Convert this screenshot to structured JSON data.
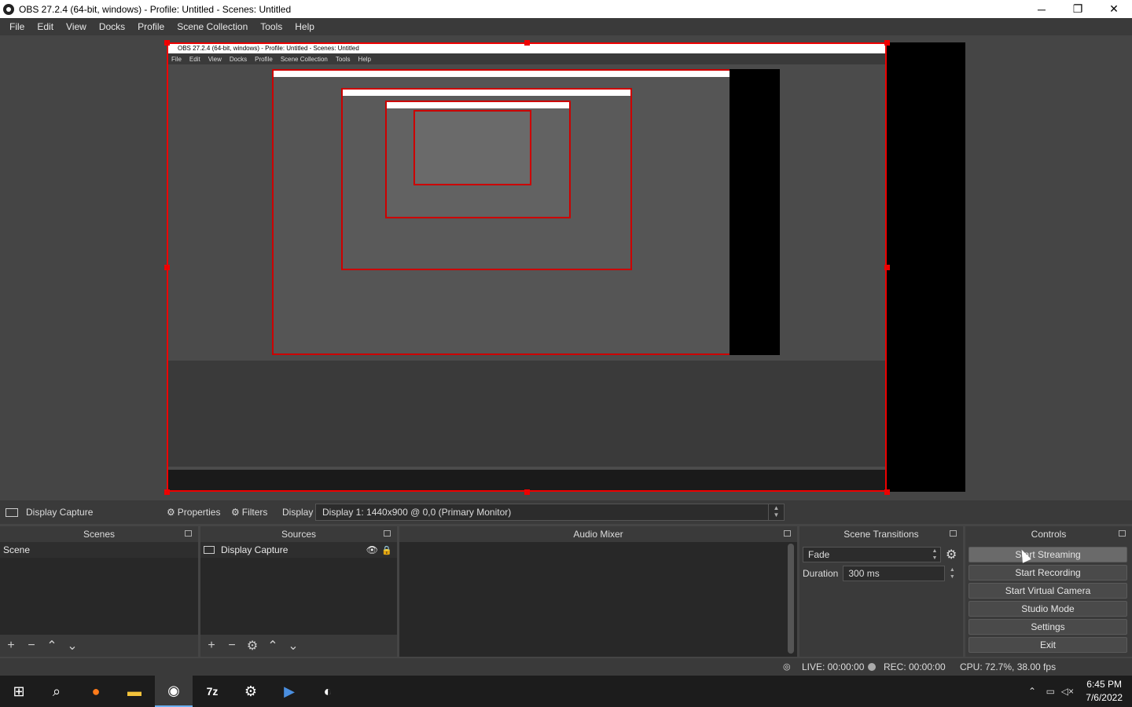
{
  "window": {
    "title": "OBS 27.2.4 (64-bit, windows) - Profile: Untitled - Scenes: Untitled",
    "controls": {
      "minimize": "─",
      "restore": "❐",
      "close": "✕"
    }
  },
  "menubar": {
    "items": [
      "File",
      "Edit",
      "View",
      "Docks",
      "Profile",
      "Scene Collection",
      "Tools",
      "Help"
    ]
  },
  "preview": {
    "captured": {
      "title": "OBS 27.2.4 (64-bit, windows) - Profile: Untitled - Scenes: Untitled",
      "menu": [
        "File",
        "Edit",
        "View",
        "Docks",
        "Profile",
        "Scene Collection",
        "Tools",
        "Help"
      ]
    },
    "selection_color": "#e00000"
  },
  "source_toolbar": {
    "source_name": "Display Capture",
    "properties_label": "Properties",
    "filters_label": "Filters",
    "display_label": "Display",
    "display_value": "Display 1: 1440x900 @ 0,0 (Primary Monitor)"
  },
  "scenes": {
    "title": "Scenes",
    "items": [
      "Scene"
    ]
  },
  "sources": {
    "title": "Sources",
    "items": [
      {
        "name": "Display Capture"
      }
    ]
  },
  "audio_mixer": {
    "title": "Audio Mixer"
  },
  "transitions": {
    "title": "Scene Transitions",
    "selected": "Fade",
    "duration_label": "Duration",
    "duration_value": "300 ms"
  },
  "controls": {
    "title": "Controls",
    "buttons": [
      "Start Streaming",
      "Start Recording",
      "Start Virtual Camera",
      "Studio Mode",
      "Settings",
      "Exit"
    ]
  },
  "status": {
    "live": "LIVE: 00:00:00",
    "rec": "REC: 00:00:00",
    "cpu": "CPU: 72.7%, 38.00 fps"
  },
  "taskbar": {
    "icons": [
      "windows-start-icon",
      "search-icon",
      "firefox-icon",
      "file-explorer-icon",
      "obs-icon",
      "7zip-icon",
      "settings-icon",
      "powershell-icon",
      "xbox-icon"
    ],
    "time": "6:45 PM",
    "date": "7/6/2022"
  }
}
